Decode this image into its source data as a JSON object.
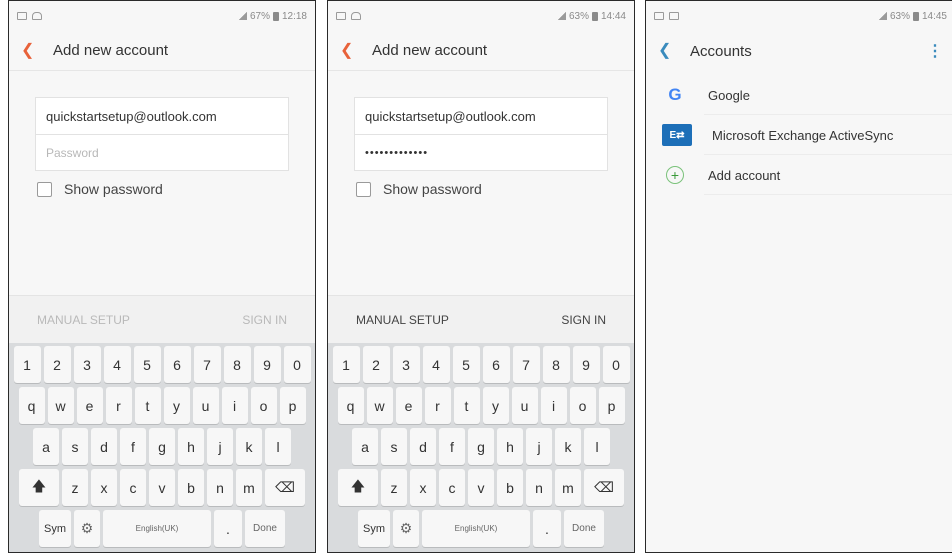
{
  "screens": [
    {
      "status": {
        "battery": "67%",
        "time": "12:18"
      },
      "title": "Add new account",
      "email": "quickstartsetup@outlook.com",
      "password_placeholder": "Password",
      "show_password": "Show password",
      "manual_setup": "MANUAL SETUP",
      "sign_in": "SIGN IN"
    },
    {
      "status": {
        "battery": "63%",
        "time": "14:44"
      },
      "title": "Add new account",
      "email": "quickstartsetup@outlook.com",
      "password_masked": "•••••••••••••",
      "show_password": "Show password",
      "manual_setup": "MANUAL SETUP",
      "sign_in": "SIGN IN"
    },
    {
      "status": {
        "battery": "63%",
        "time": "14:45"
      },
      "title": "Accounts",
      "accounts": [
        {
          "label": "Google",
          "icon": "google-icon"
        },
        {
          "label": "Microsoft Exchange ActiveSync",
          "icon": "exchange-icon"
        },
        {
          "label": "Add account",
          "icon": "plus-icon"
        }
      ]
    }
  ],
  "keyboard": {
    "numbers": [
      "1",
      "2",
      "3",
      "4",
      "5",
      "6",
      "7",
      "8",
      "9",
      "0"
    ],
    "row1": [
      "q",
      "w",
      "e",
      "r",
      "t",
      "y",
      "u",
      "i",
      "o",
      "p"
    ],
    "row2": [
      "a",
      "s",
      "d",
      "f",
      "g",
      "h",
      "j",
      "k",
      "l"
    ],
    "row3": [
      "z",
      "x",
      "c",
      "v",
      "b",
      "n",
      "m"
    ],
    "sym": "Sym",
    "space": "English(UK)",
    "dot": ".",
    "done": "Done"
  },
  "icons": {
    "back": "chevron-left-icon",
    "shift": "shift-icon",
    "delete": "backspace-icon",
    "settings": "gear-icon",
    "more": "kebab-menu-icon"
  },
  "colors": {
    "accent_orange": "#e8623a",
    "accent_blue": "#3a8bbd",
    "exchange_blue": "#1d6fb8"
  }
}
